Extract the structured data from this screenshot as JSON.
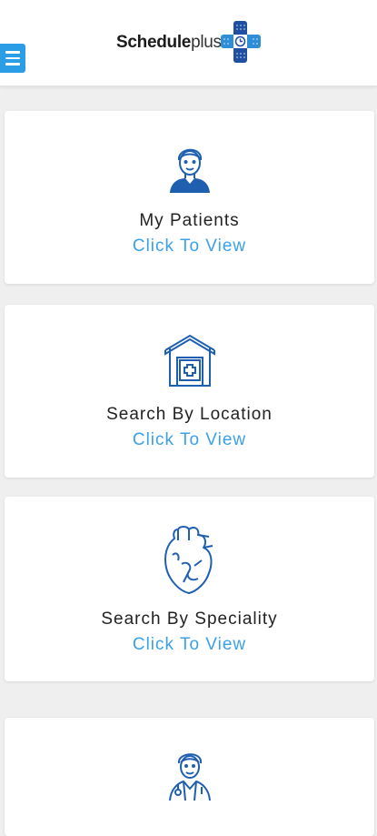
{
  "header": {
    "logo_bold": "Schedule",
    "logo_light": "plus"
  },
  "cards": [
    {
      "title": "My Patients",
      "link": "Click To View",
      "icon": "patient-icon"
    },
    {
      "title": "Search By Location",
      "link": "Click To View",
      "icon": "hospital-icon"
    },
    {
      "title": "Search By Speciality",
      "link": "Click To View",
      "icon": "heart-icon"
    },
    {
      "title": "",
      "link": "",
      "icon": "doctor-icon"
    }
  ],
  "colors": {
    "accent": "#3aa0e8",
    "menu_button": "#2a9de6",
    "icon_blue": "#1f5fb0",
    "background": "#efefef"
  }
}
